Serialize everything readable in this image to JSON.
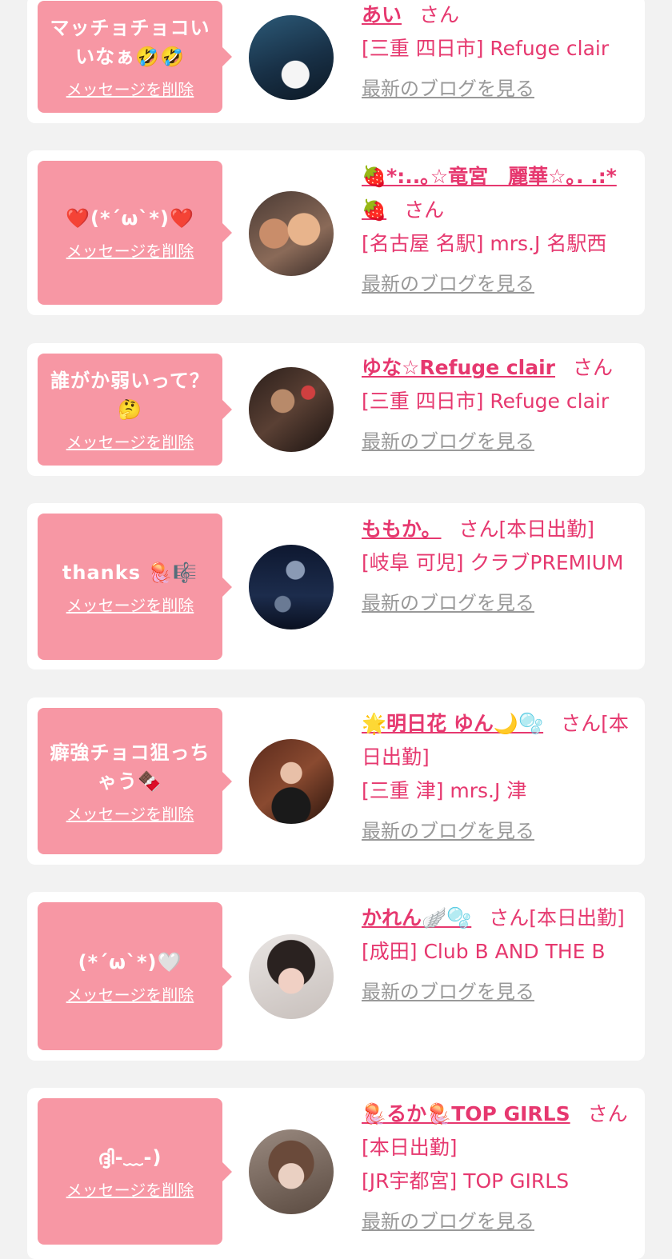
{
  "delete_label": "メッセージを削除",
  "blog_label": "最新のブログを見る",
  "san": "さん",
  "colors": {
    "background": "#f2f2f2",
    "bubble": "#f797a4",
    "accent": "#e6386f",
    "link_gray": "#999999"
  },
  "items": [
    {
      "message": "マッチョチョコいいなぁ🤣🤣",
      "name": "あい",
      "status": "",
      "shop": "[三重 四日市] Refuge clair"
    },
    {
      "message": "❤️(*´ω`*)❤️",
      "name": "🍓*:..｡☆竜宮　麗華☆｡. .:*🍓",
      "status": "",
      "shop": "[名古屋 名駅] mrs.J 名駅西"
    },
    {
      "message": "誰がか弱いって？🤔",
      "name": "ゆな☆Refuge clair",
      "status": "",
      "shop": "[三重 四日市] Refuge clair"
    },
    {
      "message": "thanks 🪼🎼",
      "name": "ももか。",
      "status": "[本日出勤]",
      "shop": "[岐阜 可児] クラブPREMIUM"
    },
    {
      "message": "癖強チョコ狙っちゃう🍫",
      "name": "🌟明日花 ゆん🌙🫧",
      "status": "[本日出勤]",
      "shop": "[三重 津] mrs.J 津"
    },
    {
      "message": "(*´ω`*)🤍",
      "name": "かれん🪽🫧",
      "status": "[本日出勤]",
      "shop": "[成田] Club B AND THE B"
    },
    {
      "message": "ദ്ദി-﹏-)",
      "name": "🪼るか🪼TOP GIRLS",
      "status": "[本日出勤]",
      "shop": "[JR宇都宮] TOP GIRLS"
    }
  ]
}
